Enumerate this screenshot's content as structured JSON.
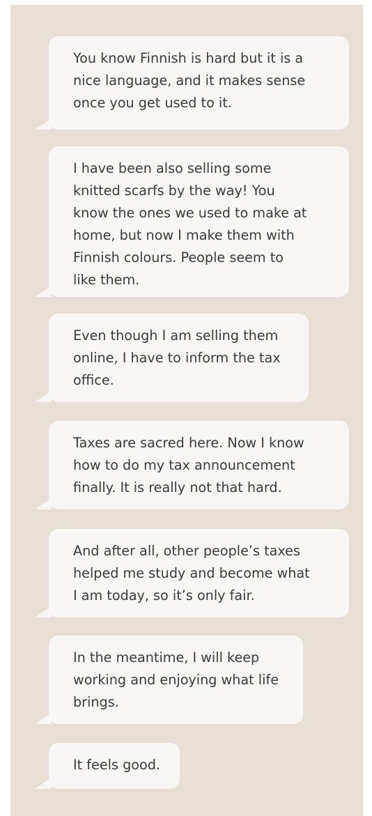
{
  "conversation": {
    "messages": [
      {
        "text": "You know Finnish is hard but it is a\nnice language, and it makes sense\nonce you get used to it."
      },
      {
        "text": "I have been also selling some\nknitted scarfs by the way! You\nknow the ones we used to make at\nhome, but now I make them with\nFinnish colours. People seem to\nlike them."
      },
      {
        "text": "Even though I am selling them\nonline, I have to inform the tax\noffice."
      },
      {
        "text": "Taxes are sacred here. Now I know\nhow to do my tax announcement\nfinally. It is really not that hard."
      },
      {
        "text": "And after all, other people’s taxes\nhelped me study and become what\nI am today, so it’s only fair."
      },
      {
        "text": "In the meantime, I will keep\nworking and enjoying what life\nbrings."
      },
      {
        "text": "It feels good."
      }
    ]
  },
  "colors": {
    "background": "#e8e0d5",
    "bubble": "#f7f6f5",
    "text": "#3a3a3a"
  }
}
